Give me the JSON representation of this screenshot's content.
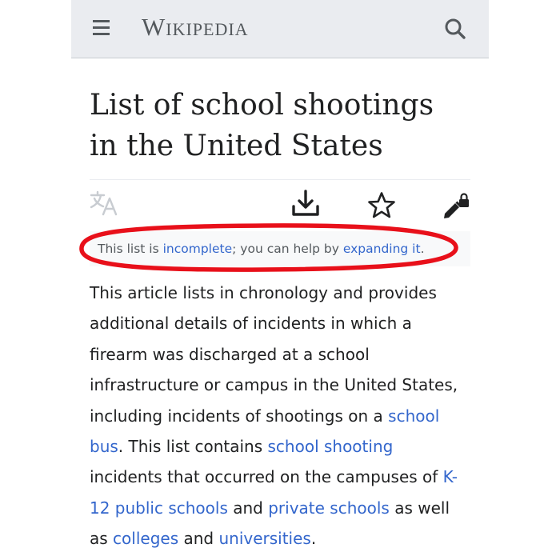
{
  "header": {
    "wordmark": "Wikipedia",
    "menu_icon": "menu-icon",
    "search_icon": "search-icon"
  },
  "page": {
    "title_line1": "List of school shootings",
    "title_line2": "in the United States"
  },
  "actions": {
    "language_icon": "language-icon",
    "download_icon": "download-icon",
    "watch_icon": "star-icon",
    "edit_icon": "edit-lock-icon"
  },
  "notice": {
    "prefix": "This list is ",
    "link1": "incomplete",
    "middle": "; you can help by ",
    "link2": "expanding it",
    "suffix": "."
  },
  "intro": {
    "line1": "This article lists in chronology and provides",
    "line2": "additional details of incidents in which a",
    "line3": "firearm was discharged at a school",
    "line4": "infrastructure or campus in the United States,",
    "line5_text": "including incidents of shootings on a ",
    "line5_link": "school",
    "line6_link": "bus",
    "line6_text": ". This list contains ",
    "line6_link2": "school shooting",
    "line7_text": "incidents that occurred on the campuses of ",
    "line7_link": "K-",
    "line8_link": "12 public schools",
    "line8_text": " and ",
    "line8_link2": "private schools",
    "line8_text2": " as well",
    "line9_text": "as ",
    "line9_link": "colleges",
    "line9_text2": " and ",
    "line9_link2": "universities",
    "line9_text3": "."
  },
  "colors": {
    "link": "#3366cc",
    "text": "#202122",
    "header_bg": "#eaecf0",
    "annotation": "#e8101a"
  }
}
